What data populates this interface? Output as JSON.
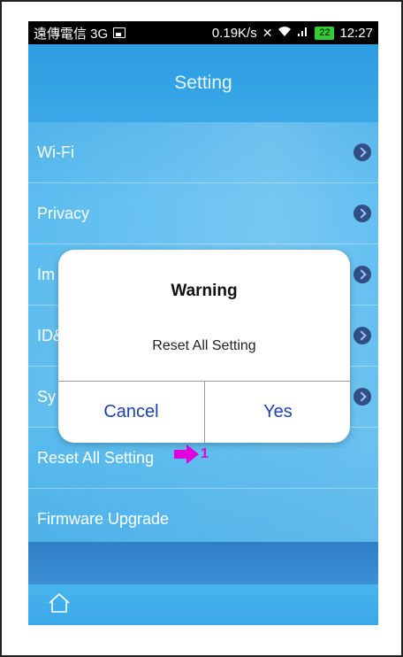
{
  "status_bar": {
    "carrier": "遠傳電信 3G",
    "speed": "0.19K/s",
    "battery": "22",
    "time": "12:27"
  },
  "header": {
    "title": "Setting"
  },
  "menu": {
    "items": [
      {
        "label": "Wi-Fi"
      },
      {
        "label": "Privacy"
      },
      {
        "label": "Im"
      },
      {
        "label": "ID&"
      },
      {
        "label": "Sy"
      },
      {
        "label": "Reset All Setting"
      },
      {
        "label": "Firmware Upgrade"
      }
    ]
  },
  "annotation": {
    "label": "1",
    "color": "#e000e0"
  },
  "dialog": {
    "title": "Warning",
    "message": "Reset All Setting",
    "cancel_label": "Cancel",
    "yes_label": "Yes"
  },
  "icons": {
    "chevron": "chevron-right-icon",
    "home": "home-icon"
  }
}
